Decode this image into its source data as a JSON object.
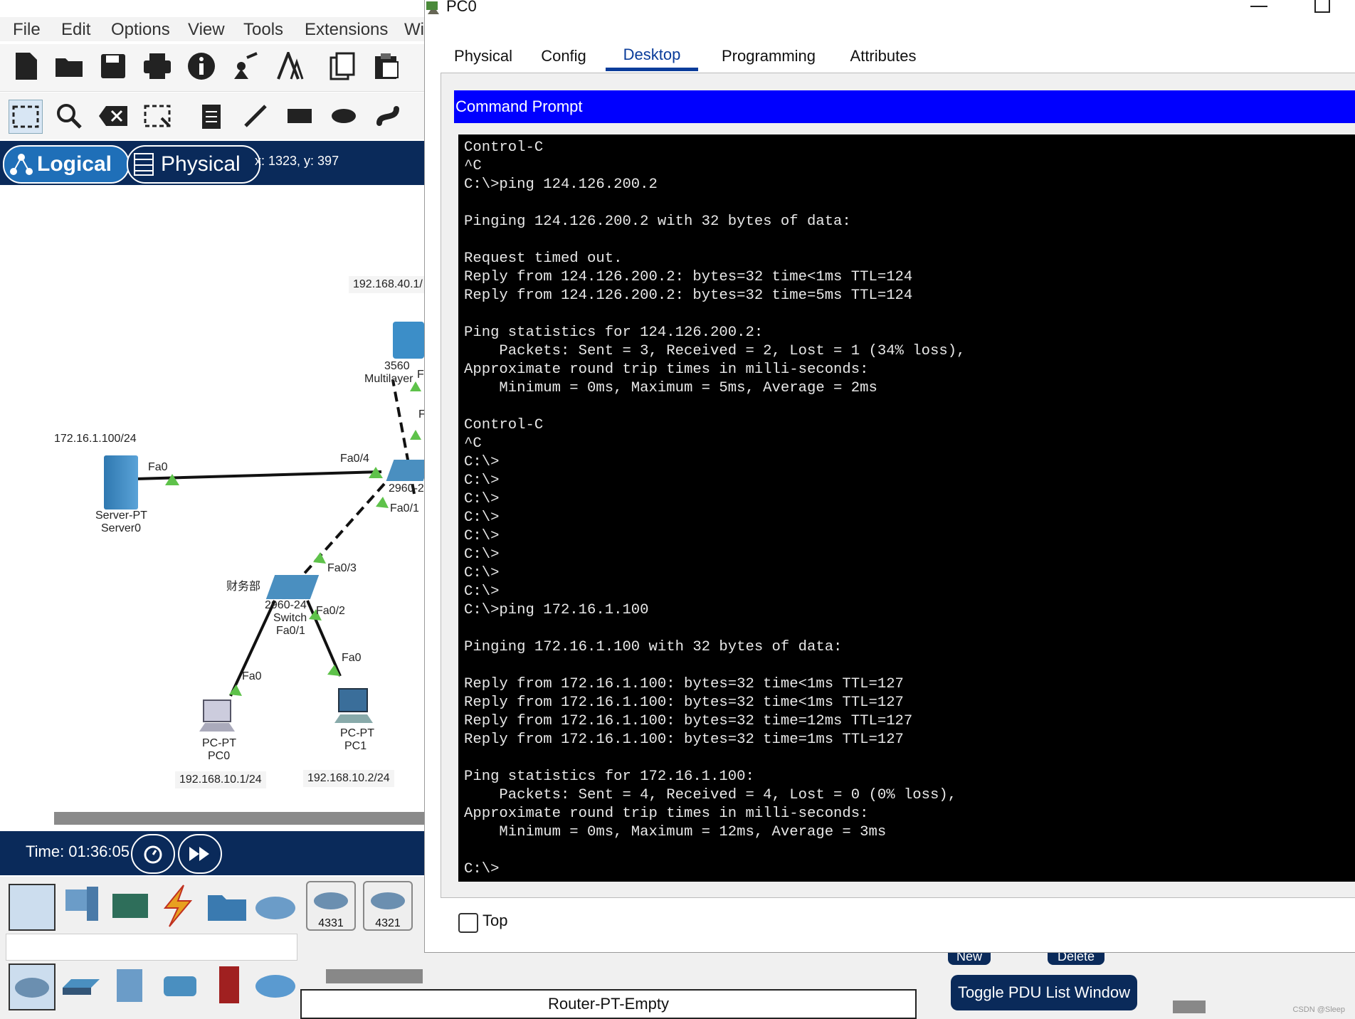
{
  "main": {
    "menu": [
      "File",
      "Edit",
      "Options",
      "View",
      "Tools",
      "Extensions",
      "Wi"
    ],
    "view_tabs": {
      "logical": "Logical",
      "physical": "Physical"
    },
    "coords": "x: 1323, y: 397",
    "time": "Time: 01:36:05",
    "topology": {
      "ip_top": "192.168.40.1/",
      "multilayer_l1": "3560",
      "multilayer_l2": "Multilayer",
      "multilayer_port_f": "F",
      "multilayer_port_f2": "F",
      "server_ip": "172.16.1.100/24",
      "server_port": "Fa0",
      "server_model": "Server-PT",
      "server_name": "Server0",
      "sw_port_fa04": "Fa0/4",
      "sw_model": "2960-2",
      "sw_port_fa01": "Fa0/1",
      "finance_label": "财务部",
      "sw2_port_fa03": "Fa0/3",
      "sw2_model": "2960-24",
      "sw2_name": "Switch",
      "sw2_port_fa02": "Fa0/2",
      "sw2_port_fa01": "Fa0/1",
      "pc0_port": "Fa0",
      "pc1_port": "Fa0",
      "pc0_model": "PC-PT",
      "pc0_name": "PC0",
      "pc1_model": "PC-PT",
      "pc1_name": "PC1",
      "pc0_ip": "192.168.10.1/24",
      "pc1_ip": "192.168.10.2/24"
    },
    "devices": {
      "router1": "4331",
      "router2": "4321"
    },
    "router_name": "Router-PT-Empty",
    "pdu": {
      "new": "New",
      "delete": "Delete",
      "toggle": "Toggle PDU List Window"
    },
    "watermark": "CSDN @Sleep"
  },
  "pc0": {
    "title": "PC0",
    "tabs": [
      "Physical",
      "Config",
      "Desktop",
      "Programming",
      "Attributes"
    ],
    "active_tab": "Desktop",
    "header": "Command Prompt",
    "terminal_lines": [
      "Control-C",
      "^C",
      "C:\\>ping 124.126.200.2",
      "",
      "Pinging 124.126.200.2 with 32 bytes of data:",
      "",
      "Request timed out.",
      "Reply from 124.126.200.2: bytes=32 time<1ms TTL=124",
      "Reply from 124.126.200.2: bytes=32 time=5ms TTL=124",
      "",
      "Ping statistics for 124.126.200.2:",
      "    Packets: Sent = 3, Received = 2, Lost = 1 (34% loss),",
      "Approximate round trip times in milli-seconds:",
      "    Minimum = 0ms, Maximum = 5ms, Average = 2ms",
      "",
      "Control-C",
      "^C",
      "C:\\>",
      "C:\\>",
      "C:\\>",
      "C:\\>",
      "C:\\>",
      "C:\\>",
      "C:\\>",
      "C:\\>",
      "C:\\>ping 172.16.1.100",
      "",
      "Pinging 172.16.1.100 with 32 bytes of data:",
      "",
      "Reply from 172.16.1.100: bytes=32 time<1ms TTL=127",
      "Reply from 172.16.1.100: bytes=32 time<1ms TTL=127",
      "Reply from 172.16.1.100: bytes=32 time=12ms TTL=127",
      "Reply from 172.16.1.100: bytes=32 time=1ms TTL=127",
      "",
      "Ping statistics for 172.16.1.100:",
      "    Packets: Sent = 4, Received = 4, Lost = 0 (0% loss),",
      "Approximate round trip times in milli-seconds:",
      "    Minimum = 0ms, Maximum = 12ms, Average = 3ms",
      "",
      "C:\\>"
    ],
    "top_checkbox_label": "Top"
  }
}
